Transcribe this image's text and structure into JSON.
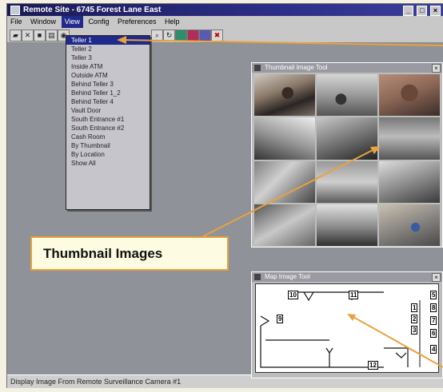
{
  "window": {
    "title": "Remote Site - 6745 Forest Lane East",
    "buttons": [
      "_",
      "□",
      "×"
    ]
  },
  "menubar": {
    "items": [
      "File",
      "Window",
      "View",
      "Config",
      "Preferences",
      "Help"
    ],
    "active": "View"
  },
  "view_menu": {
    "items": [
      "Teller 1",
      "Teller 2",
      "Teller 3",
      "Inside ATM",
      "Outside ATM",
      "Behind Teller 3",
      "Behind Teller 1_2",
      "Behind Teller 4",
      "Vault Door",
      "South Entrance #1",
      "South Entrance #2",
      "Cash Room",
      "By Thumbnail",
      "By Location",
      "Show All"
    ],
    "selected": "Teller 1"
  },
  "thumbnail_panel": {
    "title": "Thumbnail Image Tool",
    "close": "×"
  },
  "map_panel": {
    "title": "Map Image Tool",
    "close": "×",
    "rooms": [
      "10",
      "11",
      "9",
      "5",
      "8",
      "7",
      "6",
      "1",
      "2",
      "3",
      "4",
      "12"
    ]
  },
  "callout": {
    "label": "Thumbnail Images",
    "color": "#e8a23e"
  },
  "status": {
    "text": "Display Image From Remote Surveillance Camera #1"
  },
  "colors": {
    "titlebar": "#1b1a55",
    "selection": "#1f2a8a",
    "workspace": "#8f9298"
  }
}
